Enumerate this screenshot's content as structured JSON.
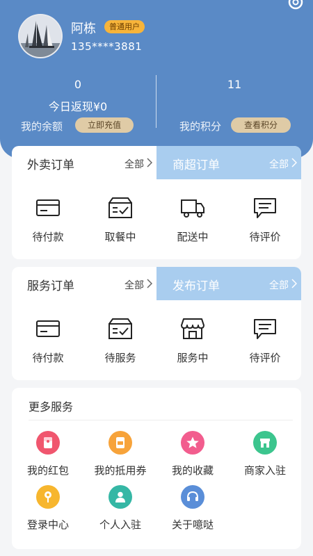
{
  "profile": {
    "name": "阿栋",
    "badge": "普通用户",
    "phone": "135****3881",
    "avatar_icon": "sailboat-photo"
  },
  "stats": {
    "left_value": "0",
    "cashback": "今日返现¥0",
    "balance_label": "我的余额",
    "recharge_button": "立即充值",
    "right_value": "11",
    "points_label": "我的积分",
    "view_points_button": "查看积分"
  },
  "orders_card": {
    "left_tab": {
      "title": "外卖订单",
      "all": "全部"
    },
    "right_tab": {
      "title": "商超订单",
      "all": "全部"
    },
    "items": [
      {
        "label": "待付款",
        "icon": "card-icon"
      },
      {
        "label": "取餐中",
        "icon": "box-check-icon"
      },
      {
        "label": "配送中",
        "icon": "truck-icon"
      },
      {
        "label": "待评价",
        "icon": "chat-icon"
      }
    ]
  },
  "service_card": {
    "left_tab": {
      "title": "服务订单",
      "all": "全部"
    },
    "right_tab": {
      "title": "发布订单",
      "all": "全部"
    },
    "items": [
      {
        "label": "待付款",
        "icon": "card-icon"
      },
      {
        "label": "待服务",
        "icon": "box-check-icon"
      },
      {
        "label": "服务中",
        "icon": "store-icon"
      },
      {
        "label": "待评价",
        "icon": "chat-icon"
      }
    ]
  },
  "more": {
    "title": "更多服务",
    "items": [
      {
        "label": "我的红包",
        "icon": "red-packet-icon",
        "color": "#f0566e"
      },
      {
        "label": "我的抵用券",
        "icon": "coupon-icon",
        "color": "#f7a33a"
      },
      {
        "label": "我的收藏",
        "icon": "star-icon",
        "color": "#f25d8e"
      },
      {
        "label": "商家入驻",
        "icon": "shop-icon",
        "color": "#3cc58e"
      },
      {
        "label": "登录中心",
        "icon": "location-pin-icon",
        "color": "#f7b62e"
      },
      {
        "label": "个人入驻",
        "icon": "person-icon",
        "color": "#35b7a5"
      },
      {
        "label": "关于噫哒",
        "icon": "headset-icon",
        "color": "#5a8ed8"
      }
    ]
  }
}
